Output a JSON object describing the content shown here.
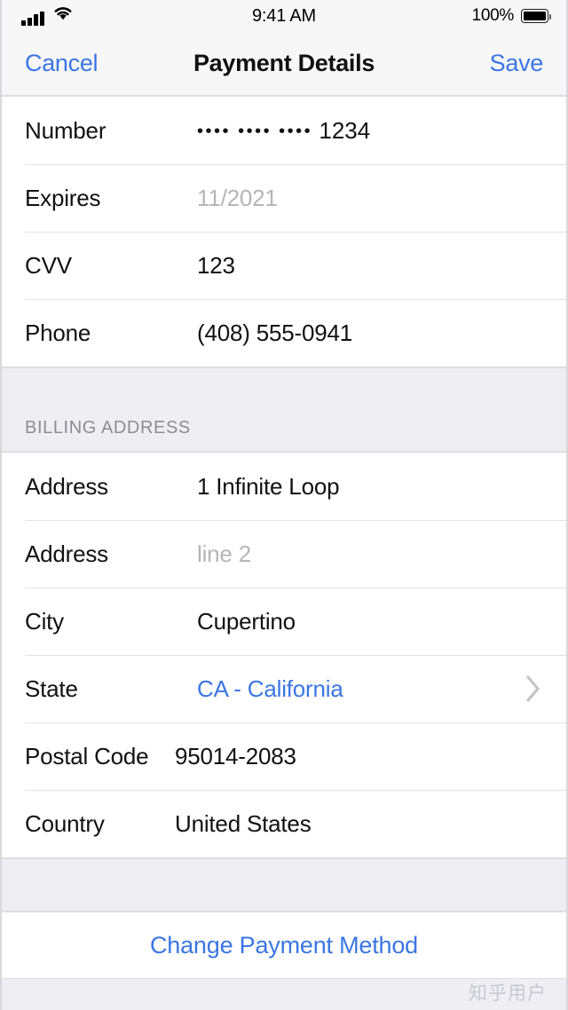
{
  "status_bar": {
    "time": "9:41 AM",
    "battery_percent": "100%",
    "signal_icon": "cellular-signal-icon",
    "wifi_icon": "wifi-icon",
    "battery_icon": "battery-full-icon"
  },
  "nav_bar": {
    "cancel_label": "Cancel",
    "title": "Payment Details",
    "save_label": "Save"
  },
  "colors": {
    "accent_blue": "#3b76e3",
    "placeholder_gray": "#b5b5ba",
    "section_header_gray": "#8c8c92",
    "group_background": "#eeeef3",
    "row_background": "#ffffff",
    "separator": "#e3e3e6"
  },
  "card_section": {
    "rows": [
      {
        "label": "Number",
        "value": "•••• •••• •••• 1234",
        "value_style": "masked",
        "masked_prefix": "•••• •••• ••••",
        "masked_suffix": "1234"
      },
      {
        "label": "Expires",
        "value": "11/2021",
        "value_style": "placeholder"
      },
      {
        "label": "CVV",
        "value": "123",
        "value_style": "normal"
      },
      {
        "label": "Phone",
        "value": "(408) 555-0941",
        "value_style": "normal"
      }
    ]
  },
  "billing_section": {
    "header": "BILLING ADDRESS",
    "rows": [
      {
        "label": "Address",
        "value": "1 Infinite Loop",
        "value_style": "normal"
      },
      {
        "label": "Address",
        "value": "line 2",
        "value_style": "placeholder"
      },
      {
        "label": "City",
        "value": "Cupertino",
        "value_style": "normal"
      },
      {
        "label": "State",
        "value": "CA - California",
        "value_style": "link",
        "accessory": "chevron-right-icon"
      },
      {
        "label": "Postal Code",
        "value": "95014-2083",
        "value_style": "normal"
      },
      {
        "label": "Country",
        "value": "United States",
        "value_style": "normal"
      }
    ]
  },
  "footer": {
    "change_payment_label": "Change Payment Method"
  },
  "watermark": {
    "text": "知乎用户"
  }
}
